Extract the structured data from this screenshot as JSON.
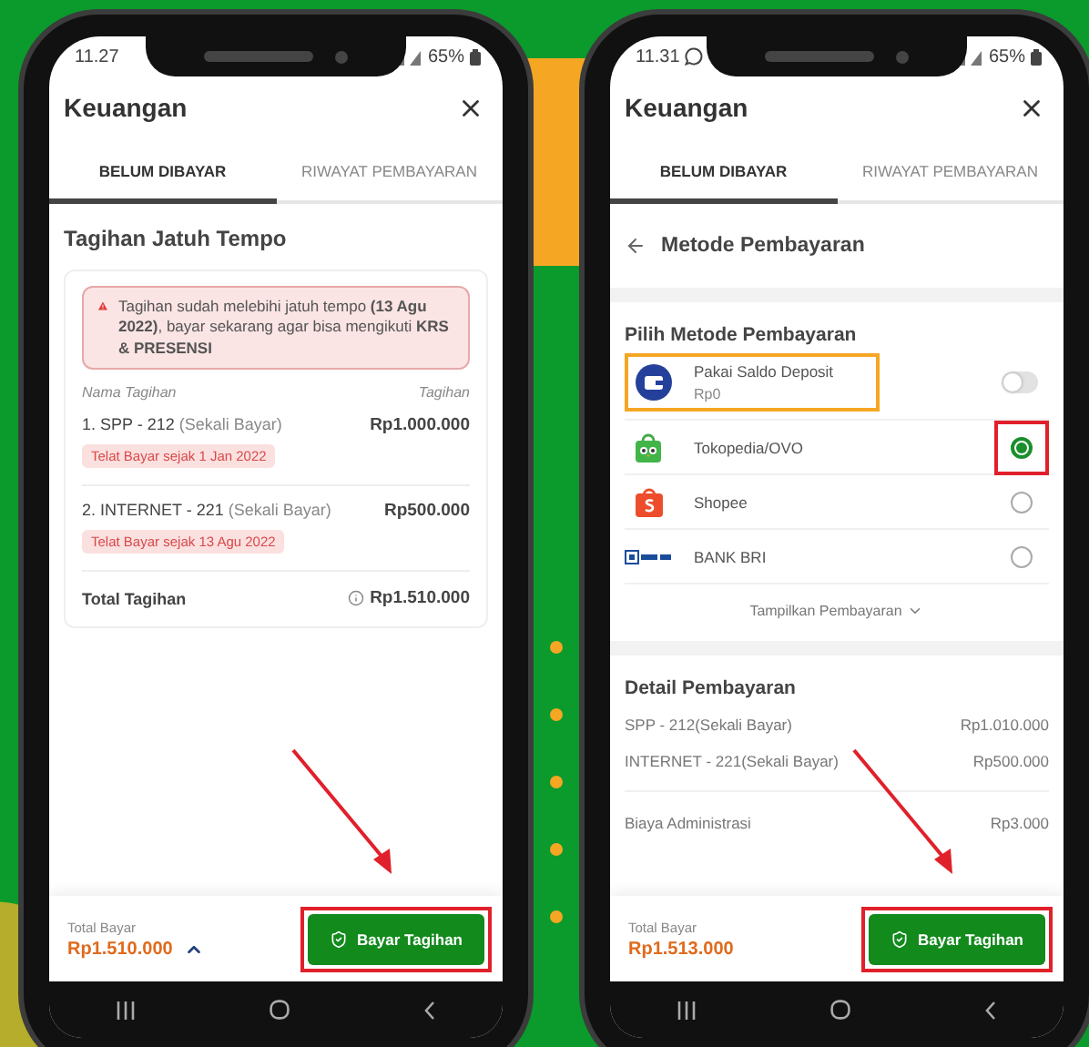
{
  "phones": [
    {
      "status": {
        "time": "11.27",
        "battery": "65%",
        "notification_icon": false
      },
      "title": "Keuangan",
      "tabs": [
        {
          "label": "BELUM DIBAYAR",
          "selected": true
        },
        {
          "label": "RIWAYAT PEMBAYARAN",
          "selected": false
        }
      ],
      "screen": {
        "kind": "bills",
        "section_title": "Tagihan Jatuh Tempo",
        "alert": "Tagihan sudah melebihi jatuh tempo **(13 Agu 2022)**, bayar sekarang agar bisa mengikuti **KRS & PRESENSI**",
        "columns": [
          "Nama Tagihan",
          "Tagihan"
        ],
        "items": [
          {
            "name": "1. SPP - 212",
            "note": "(Sekali Bayar)",
            "amount": "Rp1.000.000",
            "badge": "Telat Bayar sejak 1 Jan 2022"
          },
          {
            "name": "2. INTERNET - 221",
            "note": "(Sekali Bayar)",
            "amount": "Rp500.000",
            "badge": "Telat Bayar sejak 13 Agu 2022"
          }
        ],
        "total": {
          "label": "Total Tagihan",
          "amount": "Rp1.510.000"
        }
      },
      "footer": {
        "label": "Total Bayar",
        "amount": "Rp1.510.000",
        "expandable": true,
        "button": "Bayar Tagihan",
        "highlighted": true
      }
    },
    {
      "status": {
        "time": "11.31",
        "battery": "65%",
        "notification_icon": true
      },
      "title": "Keuangan",
      "tabs": [
        {
          "label": "BELUM DIBAYAR",
          "selected": true
        },
        {
          "label": "RIWAYAT PEMBAYARAN",
          "selected": false
        }
      ],
      "screen": {
        "kind": "payment",
        "back_title": "Metode Pembayaran",
        "methods_title": "Pilih Metode Pembayaran",
        "deposit": {
          "label": "Pakai Saldo Deposit",
          "balance": "Rp0",
          "on": false,
          "highlighted": true
        },
        "methods": [
          {
            "name": "Tokopedia/OVO",
            "kind": "tokopedia",
            "selected": true,
            "highlighted": true
          },
          {
            "name": "Shopee",
            "kind": "shopee",
            "selected": false,
            "highlighted": false
          },
          {
            "name": "BANK BRI",
            "kind": "bri",
            "selected": false,
            "highlighted": false
          }
        ],
        "show_more": "Tampilkan Pembayaran",
        "detail_title": "Detail Pembayaran",
        "detail_rows": [
          {
            "label": "SPP - 212(Sekali Bayar)",
            "amount": "Rp1.010.000"
          },
          {
            "label": "INTERNET - 221(Sekali Bayar)",
            "amount": "Rp500.000"
          }
        ],
        "fee": {
          "label": "Biaya Administrasi",
          "amount": "Rp3.000"
        }
      },
      "footer": {
        "label": "Total Bayar",
        "amount": "Rp1.513.000",
        "expandable": false,
        "button": "Bayar Tagihan",
        "highlighted": true
      }
    }
  ]
}
